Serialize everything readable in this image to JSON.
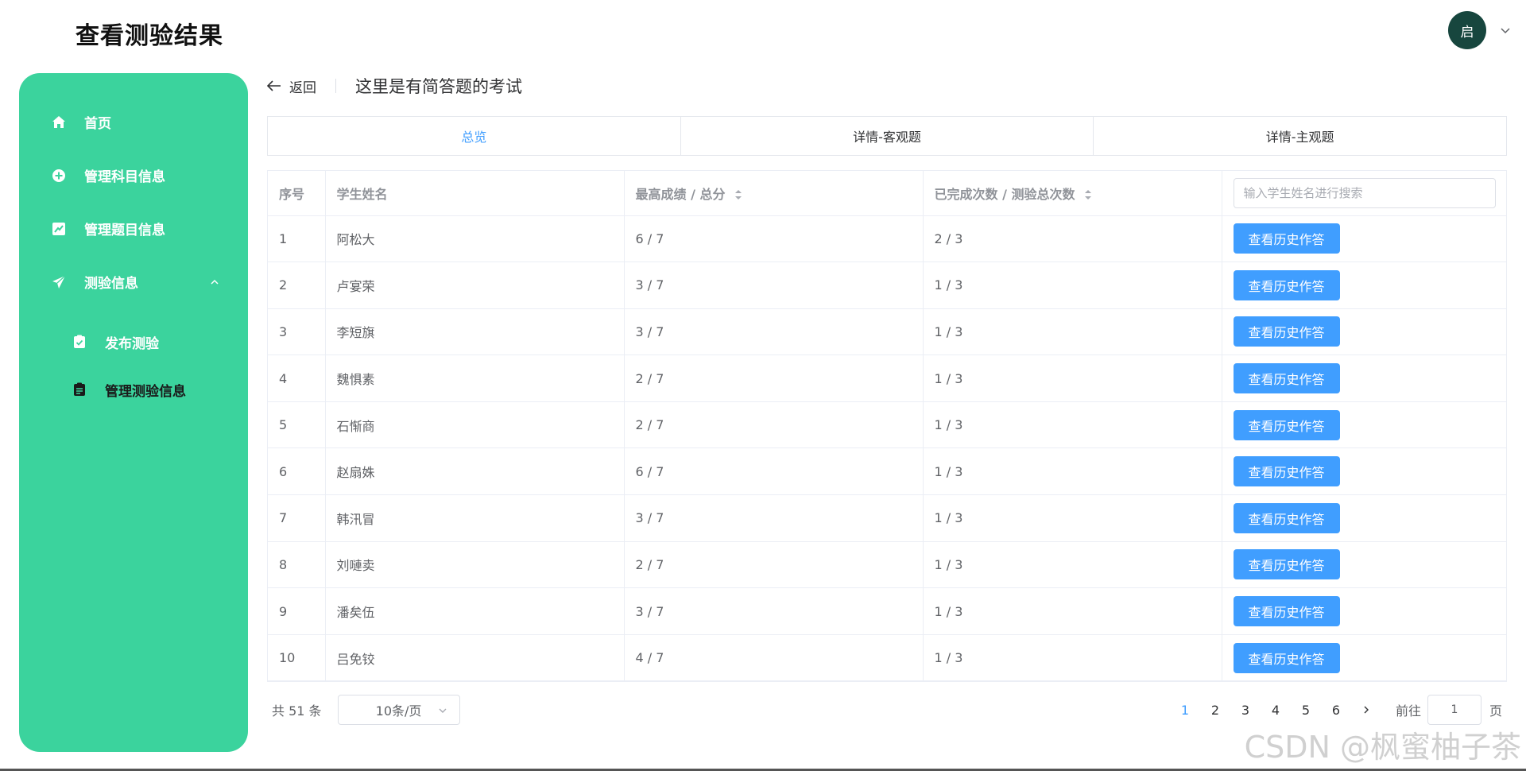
{
  "app": {
    "title": "查看测验结果"
  },
  "user": {
    "avatar_text": "启"
  },
  "sidebar": {
    "items": [
      {
        "label": "首页"
      },
      {
        "label": "管理科目信息"
      },
      {
        "label": "管理题目信息"
      },
      {
        "label": "测验信息"
      }
    ],
    "sub_items": [
      {
        "label": "发布测验"
      },
      {
        "label": "管理测验信息"
      }
    ]
  },
  "header": {
    "back_label": "返回",
    "subtitle": "这里是有简答题的考试"
  },
  "tabs": [
    {
      "label": "总览"
    },
    {
      "label": "详情-客观题"
    },
    {
      "label": "详情-主观题"
    }
  ],
  "table": {
    "columns": [
      "序号",
      "学生姓名",
      "最高成绩 / 总分",
      "已完成次数 / 测验总次数"
    ],
    "search_placeholder": "输入学生姓名进行搜索",
    "action_label": "查看历史作答",
    "rows": [
      {
        "index": "1",
        "name": "阿松大",
        "score": "6 / 7",
        "count": "2 / 3"
      },
      {
        "index": "2",
        "name": "卢宴荣",
        "score": "3 / 7",
        "count": "1 / 3"
      },
      {
        "index": "3",
        "name": "李短旗",
        "score": "3 / 7",
        "count": "1 / 3"
      },
      {
        "index": "4",
        "name": "魏惧素",
        "score": "2 / 7",
        "count": "1 / 3"
      },
      {
        "index": "5",
        "name": "石惭商",
        "score": "2 / 7",
        "count": "1 / 3"
      },
      {
        "index": "6",
        "name": "赵扇姝",
        "score": "6 / 7",
        "count": "1 / 3"
      },
      {
        "index": "7",
        "name": "韩汛冒",
        "score": "3 / 7",
        "count": "1 / 3"
      },
      {
        "index": "8",
        "name": "刘嗹卖",
        "score": "2 / 7",
        "count": "1 / 3"
      },
      {
        "index": "9",
        "name": "潘矣伍",
        "score": "3 / 7",
        "count": "1 / 3"
      },
      {
        "index": "10",
        "name": "吕免铰",
        "score": "4 / 7",
        "count": "1 / 3"
      }
    ]
  },
  "pagination": {
    "total_text": "共 51 条",
    "page_size": "10条/页",
    "pages": [
      "1",
      "2",
      "3",
      "4",
      "5",
      "6"
    ],
    "current": "1",
    "goto_label": "前往",
    "goto_value": "1",
    "page_unit": "页"
  },
  "watermark": "CSDN @枫蜜柚子茶",
  "colors": {
    "sidebar": "#3bd39d",
    "primary": "#409eff",
    "avatar": "#17463e"
  }
}
